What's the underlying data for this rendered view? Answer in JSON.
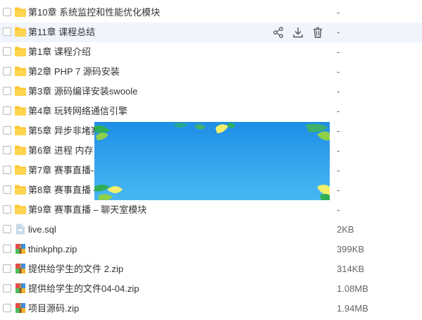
{
  "files": [
    {
      "name": "第10章 系统监控和性能优化模块",
      "size": "-",
      "type": "folder"
    },
    {
      "name": "第11章 课程总结",
      "size": "-",
      "type": "folder",
      "hover": true
    },
    {
      "name": "第1章 课程介绍",
      "size": "-",
      "type": "folder"
    },
    {
      "name": "第2章 PHP 7 源码安装",
      "size": "-",
      "type": "folder"
    },
    {
      "name": "第3章 源码编译安装swoole",
      "size": "-",
      "type": "folder"
    },
    {
      "name": "第4章 玩转网络通信引擎",
      "size": "-",
      "type": "folder"
    },
    {
      "name": "第5章 异步非堵塞",
      "size": "-",
      "type": "folder"
    },
    {
      "name": "第6章 进程 内存 t",
      "size": "-",
      "type": "folder"
    },
    {
      "name": "第7章 赛事直播--",
      "size": "-",
      "type": "folder"
    },
    {
      "name": "第8章 赛事直播 –",
      "size": "-",
      "type": "folder"
    },
    {
      "name": "第9章 赛事直播 – 聊天室模块",
      "size": "-",
      "type": "folder"
    },
    {
      "name": "live.sql",
      "size": "2KB",
      "type": "sql"
    },
    {
      "name": "thinkphp.zip",
      "size": "399KB",
      "type": "zip"
    },
    {
      "name": "提供给学生的文件 2.zip",
      "size": "314KB",
      "type": "zip"
    },
    {
      "name": "提供给学生的文件04-04.zip",
      "size": "1.08MB",
      "type": "zip"
    },
    {
      "name": "项目源码.zip",
      "size": "1.94MB",
      "type": "zip"
    }
  ],
  "row_actions": {
    "icons": [
      "share-icon",
      "download-icon",
      "delete-icon"
    ]
  },
  "colors": {
    "folder": "#ffc62e",
    "hover_row": "#f0f5fd",
    "banner_top": "#1e90e8",
    "banner_bottom": "#47b6f2"
  }
}
